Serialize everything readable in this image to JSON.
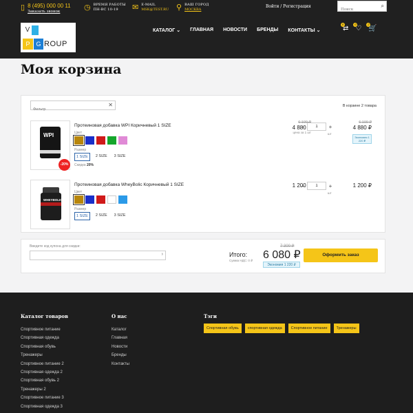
{
  "header": {
    "phone": {
      "number": "8 (495) 000 00 11",
      "link": "Заказать звонок"
    },
    "hours": {
      "label": "ВРЕМЯ РАБОТЫ",
      "value": "ПН-ВС 10-19"
    },
    "email": {
      "label": "E-MAIL",
      "value": "MSK@TEST.RU"
    },
    "city": {
      "label": "ВАШ ГОРОД",
      "value": "МОСКВА"
    },
    "login": "Войти / Регистрация",
    "search_placeholder": "Поиск",
    "nav": [
      "КАТАЛОГ",
      "ГЛАВНАЯ",
      "НОВОСТИ",
      "БРЕНДЫ",
      "КОНТАКТЫ"
    ],
    "badges": {
      "compare": "0",
      "wishlist": "0",
      "cart": "2"
    },
    "logo": {
      "v": "V",
      "p": "P",
      "g": "G",
      "roup": "ROUP"
    }
  },
  "page_title": "Моя корзина",
  "cart": {
    "filter_placeholder": "Фильтр",
    "count_text": "В корзине 2 товара",
    "items": [
      {
        "name": "Протеиновая добавка WPI Коричневый 1 SIZE",
        "color_label": "Цвет",
        "colors": [
          "#b8860b",
          "#1a2fc9",
          "#d01a1a",
          "#16a62c",
          "#e08ad6"
        ],
        "size_label": "Размер",
        "sizes": [
          "1 SIZE",
          "2 SIZE",
          "3 SIZE"
        ],
        "saving_label": "Скидка",
        "saving_value": "20%",
        "discount_badge": "-20%",
        "product_text": "WPI",
        "old_price": "6 100 ₽",
        "price": "4 880 ₽",
        "per_unit": "цена за 1 шт",
        "qty": "1",
        "unit": "шт",
        "total_old": "6 100 ₽",
        "total": "4 880 ₽",
        "economy": "Экономия 1 220 ₽"
      },
      {
        "name": "Протеиновая добавка WheyBolic Коричневый 1 SIZE",
        "color_label": "Цвет",
        "colors": [
          "#b8860b",
          "#1a2fc9",
          "#d01a1a",
          "#ffffff",
          "#2b9ae8"
        ],
        "size_label": "Размер",
        "sizes": [
          "1 SIZE",
          "2 SIZE",
          "3 SIZE"
        ],
        "product_text": "WHEYBOLIC",
        "price": "1 200 ₽",
        "qty": "1",
        "unit": "шт",
        "total": "1 200 ₽"
      }
    ]
  },
  "checkout": {
    "coupon_label": "Введите код купона для скидки:",
    "itogo": "Итого:",
    "nds": "Сумма НДС: 0 ₽",
    "old_total": "7 300 ₽",
    "total": "6 080 ₽",
    "economy": "Экономия 1 220 ₽",
    "order_button": "Оформить заказ"
  },
  "footer": {
    "catalog_title": "Каталог товаров",
    "catalog": [
      "Спортивное питание",
      "Спортивная одежда",
      "Спортивная обувь",
      "Тренажеры",
      "Спортивное питание 2",
      "Спортивная одежда 2",
      "Спортивная обувь 2",
      "Тренажеры 2",
      "Спортивное питание 3",
      "Спортивная одежда 3"
    ],
    "about_title": "О нас",
    "about": [
      "Каталог",
      "Главная",
      "Новости",
      "Бренды",
      "Контакты"
    ],
    "tags_title": "Тэги",
    "tags": [
      "Спортивная обувь",
      "спортивная одежда",
      "Спортивное питание",
      "Тренажеры"
    ]
  },
  "colors": {
    "accent": "#f5c518",
    "header_bg": "#202020",
    "footer_bg": "#1e1e1e"
  }
}
